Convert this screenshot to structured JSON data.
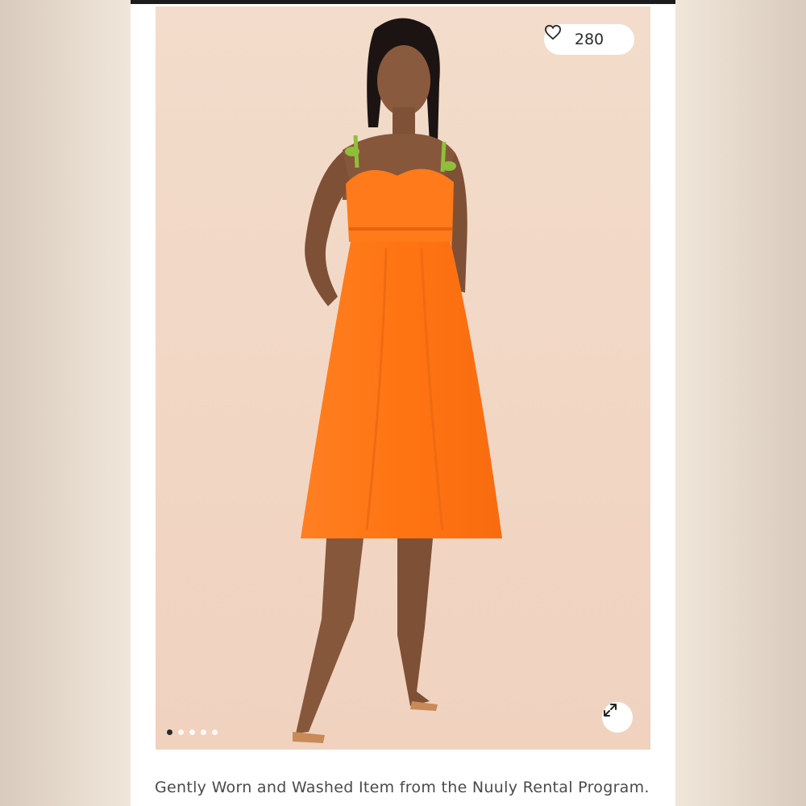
{
  "listing": {
    "likes_count": "280",
    "like_icon": "heart-icon",
    "expand_icon": "expand-arrows-icon",
    "carousel": {
      "total": 5,
      "active_index": 0
    },
    "description": "Gently Worn and Washed Item from the Nuuly Rental Program."
  },
  "colors": {
    "dress": "#ff7a1a",
    "straps": "#8fbf3a",
    "backdrop": "#f2d7c4"
  }
}
